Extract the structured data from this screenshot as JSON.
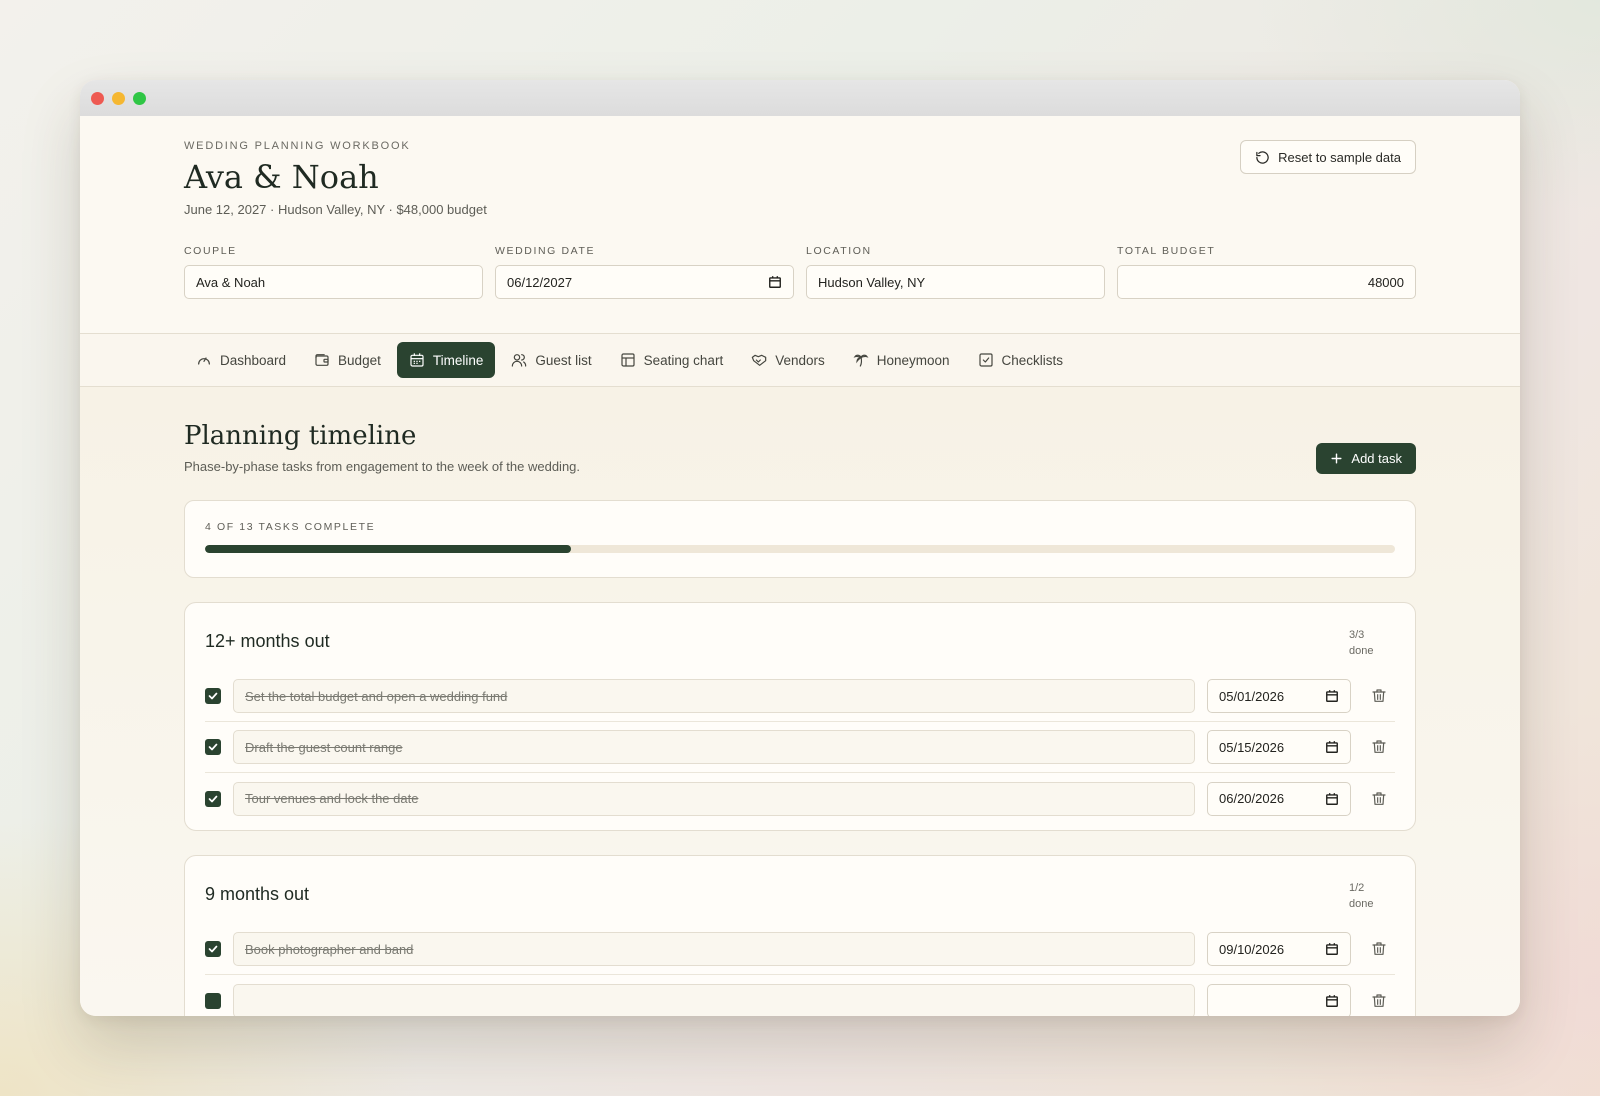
{
  "header": {
    "eyebrow": "WEDDING PLANNING WORKBOOK",
    "title": "Ava & Noah",
    "subline": "June 12, 2027 · Hudson Valley, NY · $48,000 budget",
    "reset_label": "Reset to sample data"
  },
  "fields": [
    {
      "label": "COUPLE",
      "value": "Ava & Noah"
    },
    {
      "label": "WEDDING DATE",
      "value": "06/12/2027"
    },
    {
      "label": "LOCATION",
      "value": "Hudson Valley, NY"
    },
    {
      "label": "TOTAL BUDGET",
      "value": "48000"
    }
  ],
  "nav": {
    "active": "Timeline",
    "tabs": [
      {
        "label": "Dashboard",
        "icon": "gauge-icon"
      },
      {
        "label": "Budget",
        "icon": "wallet-icon"
      },
      {
        "label": "Timeline",
        "icon": "calendar-icon"
      },
      {
        "label": "Guest list",
        "icon": "users-icon"
      },
      {
        "label": "Seating chart",
        "icon": "table-layout-icon"
      },
      {
        "label": "Vendors",
        "icon": "handshake-icon"
      },
      {
        "label": "Honeymoon",
        "icon": "palm-tree-icon"
      },
      {
        "label": "Checklists",
        "icon": "checkbox-icon"
      }
    ]
  },
  "main": {
    "title": "Planning timeline",
    "description": "Phase-by-phase tasks from engagement to the week of the wedding.",
    "add_label": "Add task",
    "progress": {
      "label": "4 OF 13 TASKS COMPLETE",
      "completed": 4,
      "total": 13
    },
    "phases": [
      {
        "title": "12+ months out",
        "count": "3/3",
        "count_suffix": "done",
        "tasks": [
          {
            "text": "Set the total budget and open a wedding fund",
            "date": "05/01/2026",
            "done": true
          },
          {
            "text": "Draft the guest count range",
            "date": "05/15/2026",
            "done": true
          },
          {
            "text": "Tour venues and lock the date",
            "date": "06/20/2026",
            "done": true
          }
        ]
      },
      {
        "title": "9 months out",
        "count": "1/2",
        "count_suffix": "done",
        "tasks": [
          {
            "text": "Book photographer and band",
            "date": "09/10/2026",
            "done": true
          },
          {
            "text": "",
            "date": "",
            "done": false
          }
        ]
      }
    ]
  },
  "colors": {
    "accent": "#2a4330",
    "background": "#fcfaf4",
    "track": "#efe7d8"
  }
}
